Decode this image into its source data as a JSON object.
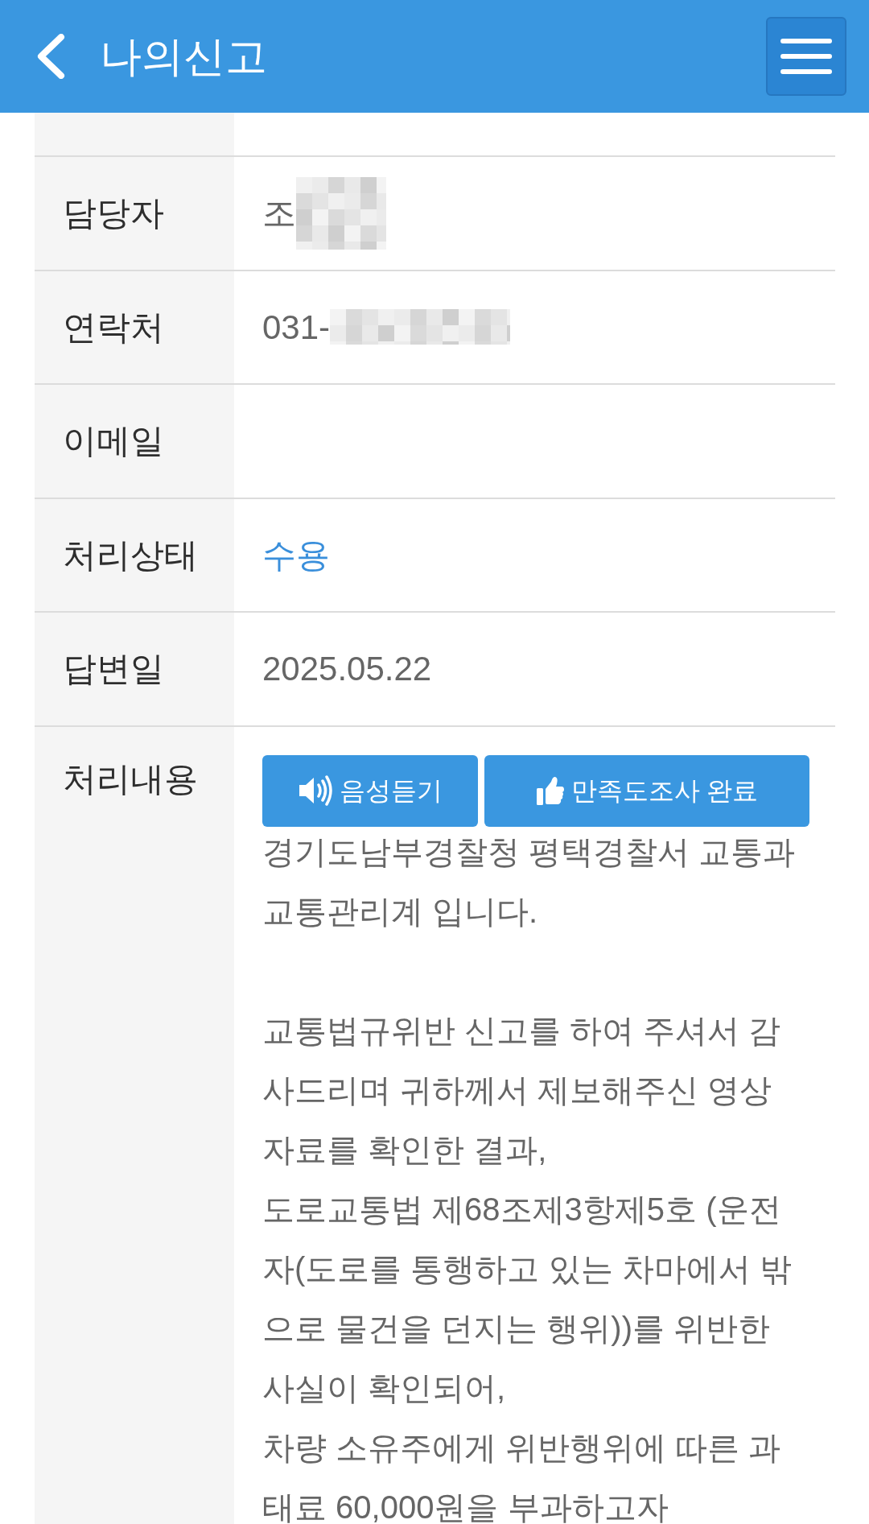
{
  "header": {
    "title": "나의신고"
  },
  "table": {
    "rows": [
      {
        "kind": "text",
        "label": "담당자",
        "value": "조",
        "redacted": true
      },
      {
        "kind": "text",
        "label": "연락처",
        "value": "031-",
        "redacted": true
      },
      {
        "kind": "text",
        "label": "이메일"
      },
      {
        "kind": "status",
        "label": "처리상태",
        "value": "수용"
      },
      {
        "kind": "text",
        "label": "답변일",
        "value": "2025.05.22"
      },
      {
        "kind": "content",
        "label": "처리내용",
        "buttons": [
          {
            "kind": "audio",
            "label": "음성듣기"
          },
          {
            "kind": "survey",
            "label": "만족도조사 완료"
          }
        ],
        "text": "경기도남부경찰청 평택경찰서 교통과 교통관리계 입니다.\n\n교통법규위반 신고를 하여 주셔서 감사드리며 귀하께서 제보해주신 영상자료를 확인한 결과,\n도로교통법 제68조제3항제5호 (운전자(도로를 통행하고 있는 차마에서 밖으로 물건을 던지는 행위))를 위반한 사실이 확인되어,\n차량 소유주에게 위반행위에 따른 과태료 60,000원을 부과하고자"
      }
    ]
  }
}
